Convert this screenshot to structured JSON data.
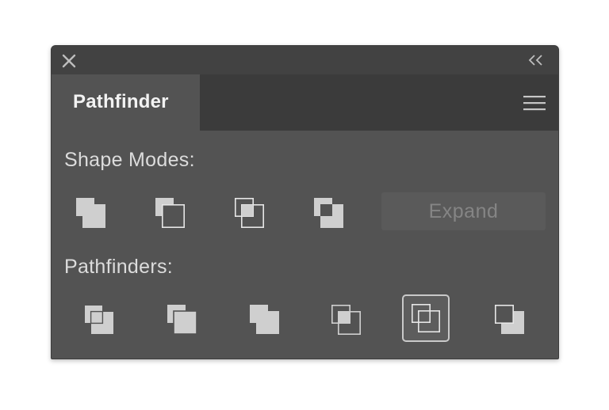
{
  "titlebar": {
    "close_icon": "close-icon",
    "collapse_icon": "double-chevron-left-icon"
  },
  "tab": {
    "label": "Pathfinder"
  },
  "menu_icon": "hamburger-menu-icon",
  "shape_modes": {
    "label": "Shape Modes:",
    "buttons": [
      "unite",
      "minus-front",
      "intersect",
      "exclude"
    ],
    "expand_label": "Expand"
  },
  "pathfinders": {
    "label": "Pathfinders:",
    "buttons": [
      "divide",
      "trim",
      "merge",
      "crop",
      "outline",
      "minus-back"
    ],
    "selected": "outline"
  },
  "colors": {
    "panel_bg": "#535353",
    "titlebar_bg": "#424242",
    "tabbar_bg": "#3b3b3b",
    "icon_light": "#cfcfcf",
    "icon_stroke": "#e6e6e6"
  }
}
